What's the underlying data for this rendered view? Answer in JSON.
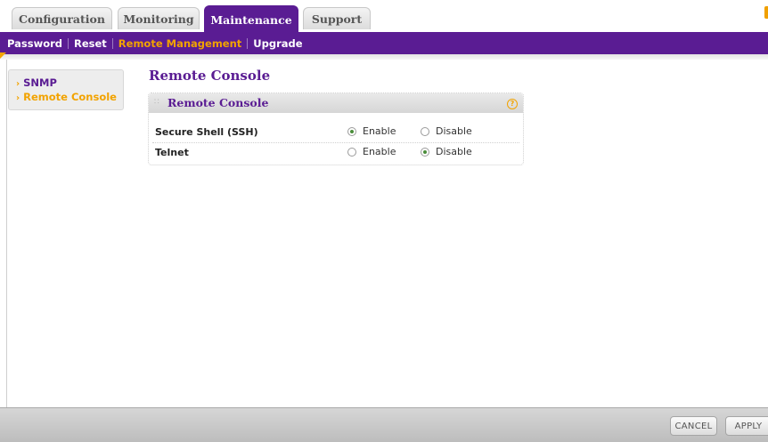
{
  "tabs": [
    {
      "label": "Configuration",
      "active": false
    },
    {
      "label": "Monitoring",
      "active": false
    },
    {
      "label": "Maintenance",
      "active": true
    },
    {
      "label": "Support",
      "active": false
    }
  ],
  "subnav": [
    {
      "label": "Password",
      "current": false
    },
    {
      "label": "Reset",
      "current": false
    },
    {
      "label": "Remote Management",
      "current": true
    },
    {
      "label": "Upgrade",
      "current": false
    }
  ],
  "leftmenu": [
    {
      "label": "SNMP",
      "current": false
    },
    {
      "label": "Remote Console",
      "current": true
    }
  ],
  "page": {
    "title": "Remote Console"
  },
  "panel": {
    "title": "Remote Console",
    "help_icon": "?",
    "rows": [
      {
        "label": "Secure Shell (SSH)",
        "enable_label": "Enable",
        "disable_label": "Disable",
        "selected": "Enable"
      },
      {
        "label": "Telnet",
        "enable_label": "Enable",
        "disable_label": "Disable",
        "selected": "Disable"
      }
    ]
  },
  "buttons": {
    "cancel": "CANCEL",
    "apply": "APPLY"
  },
  "colors": {
    "brand_purple": "#5a1c93",
    "accent_orange": "#f2a300",
    "radio_dot": "#4a8d3a"
  }
}
